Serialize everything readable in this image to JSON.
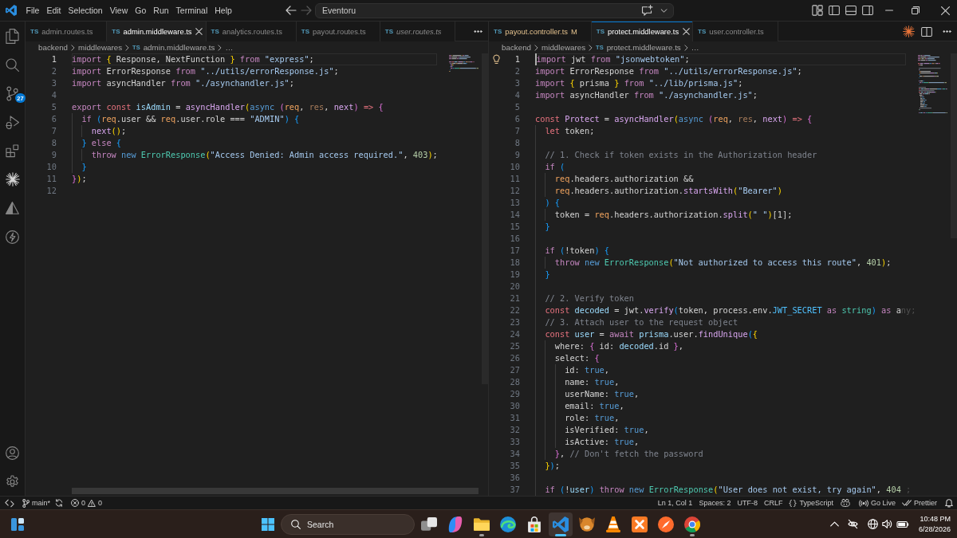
{
  "title_bar": {
    "menu": [
      "File",
      "Edit",
      "Selection",
      "View",
      "Go",
      "Run",
      "Terminal",
      "Help"
    ],
    "back_button": {
      "disabled": false
    },
    "forward_button": {
      "disabled": true
    },
    "command_center": {
      "text": "Eventoru"
    }
  },
  "activity_bar": {
    "source_control_badge": "27"
  },
  "editor_groups": [
    {
      "focused": false,
      "tabs": [
        {
          "file_type": "TS",
          "label": "admin.routes.ts",
          "selected": false,
          "preview": false,
          "modified": false
        },
        {
          "file_type": "TS",
          "label": "admin.middleware.ts",
          "selected": true,
          "preview": false,
          "modified": false
        },
        {
          "file_type": "TS",
          "label": "analytics.routes.ts",
          "selected": false,
          "preview": false,
          "modified": false
        },
        {
          "file_type": "TS",
          "label": "payout.routes.ts",
          "selected": false,
          "preview": false,
          "modified": false
        },
        {
          "file_type": "TS",
          "label": "user.routes.ts",
          "selected": false,
          "preview": true,
          "modified": false
        }
      ],
      "breadcrumb": {
        "folders": [
          "backend",
          "middlewares"
        ],
        "file_type": "TS",
        "file": "admin.middleware.ts",
        "symbol": "…"
      },
      "lines": [
        {
          "number": "1",
          "active": true,
          "tokens": [
            {
              "kind": "keyword",
              "text": "import "
            },
            {
              "kind": "bracket1",
              "text": "{"
            },
            {
              "kind": "plain",
              "text": " Response, NextFunction "
            },
            {
              "kind": "bracket1",
              "text": "} "
            },
            {
              "kind": "keyword",
              "text": "from "
            },
            {
              "kind": "string",
              "text": "\"express\""
            },
            {
              "kind": "plain",
              "text": ";"
            }
          ]
        },
        {
          "number": "2",
          "active": false,
          "tokens": [
            {
              "kind": "keyword",
              "text": "import"
            },
            {
              "kind": "plain",
              "text": " ErrorResponse "
            },
            {
              "kind": "keyword",
              "text": "from "
            },
            {
              "kind": "string",
              "text": "\"../utils/errorResponse.js\""
            },
            {
              "kind": "plain",
              "text": ";"
            }
          ]
        },
        {
          "number": "3",
          "active": false,
          "tokens": [
            {
              "kind": "keyword",
              "text": "import"
            },
            {
              "kind": "plain",
              "text": " asyncHandler "
            },
            {
              "kind": "keyword",
              "text": "from "
            },
            {
              "kind": "string",
              "text": "\"./asynchandler.js\""
            },
            {
              "kind": "plain",
              "text": ";"
            }
          ]
        },
        {
          "number": "4",
          "active": false
        },
        {
          "number": "5",
          "active": false,
          "tokens": [
            {
              "kind": "keyword",
              "text": "export "
            },
            {
              "kind": "storage",
              "text": "const "
            },
            {
              "kind": "variable",
              "text": "isAdmin"
            },
            {
              "kind": "plain",
              "text": " = "
            },
            {
              "kind": "function",
              "text": "asyncHandler"
            },
            {
              "kind": "bracket1",
              "text": "("
            },
            {
              "kind": "literal",
              "text": "async "
            },
            {
              "kind": "bracket2",
              "text": "("
            },
            {
              "kind": "parameter",
              "text": "req"
            },
            {
              "kind": "plain",
              "text": ", "
            },
            {
              "kind": "unused",
              "text": "res"
            },
            {
              "kind": "plain",
              "text": ", "
            },
            {
              "kind": "function",
              "text": "next"
            },
            {
              "kind": "bracket2",
              "text": ") "
            },
            {
              "kind": "storage",
              "text": "=> "
            },
            {
              "kind": "bracket2",
              "text": "{"
            }
          ]
        },
        {
          "number": "6",
          "active": false,
          "tokens": [
            {
              "kind": "keyword",
              "text": "  if "
            },
            {
              "kind": "bracket3",
              "text": "("
            },
            {
              "kind": "parameter",
              "text": "req"
            },
            {
              "kind": "plain",
              "text": ".user && "
            },
            {
              "kind": "parameter",
              "text": "req"
            },
            {
              "kind": "plain",
              "text": ".user.role === "
            },
            {
              "kind": "string",
              "text": "\"ADMIN\""
            },
            {
              "kind": "bracket3",
              "text": ") "
            },
            {
              "kind": "bracket3",
              "text": "{"
            }
          ]
        },
        {
          "number": "7",
          "active": false,
          "tokens": [
            {
              "kind": "function",
              "text": "    next"
            },
            {
              "kind": "bracket1",
              "text": "()"
            },
            {
              "kind": "plain",
              "text": ";"
            }
          ]
        },
        {
          "number": "8",
          "active": false,
          "tokens": [
            {
              "kind": "bracket3",
              "text": "  } "
            },
            {
              "kind": "keyword",
              "text": "else "
            },
            {
              "kind": "bracket3",
              "text": "{"
            }
          ]
        },
        {
          "number": "9",
          "active": false,
          "tokens": [
            {
              "kind": "keyword",
              "text": "    throw "
            },
            {
              "kind": "literal",
              "text": "new "
            },
            {
              "kind": "class",
              "text": "ErrorResponse"
            },
            {
              "kind": "bracket1",
              "text": "("
            },
            {
              "kind": "string",
              "text": "\"Access Denied: Admin access required.\""
            },
            {
              "kind": "plain",
              "text": ", "
            },
            {
              "kind": "number",
              "text": "403"
            },
            {
              "kind": "bracket1",
              "text": ")"
            },
            {
              "kind": "plain",
              "text": ";"
            }
          ]
        },
        {
          "number": "10",
          "active": false,
          "tokens": [
            {
              "kind": "bracket3",
              "text": "  }"
            }
          ]
        },
        {
          "number": "11",
          "active": false,
          "tokens": [
            {
              "kind": "bracket2",
              "text": "}"
            },
            {
              "kind": "bracket1",
              "text": ")"
            },
            {
              "kind": "plain",
              "text": ";"
            }
          ]
        },
        {
          "number": "12",
          "active": false
        }
      ]
    },
    {
      "focused": true,
      "lightbulb": true,
      "tabs": [
        {
          "file_type": "TS",
          "label": "payout.controller.ts",
          "git_status": "M",
          "selected": false,
          "preview": false,
          "modified": true
        },
        {
          "file_type": "TS",
          "label": "protect.middleware.ts",
          "selected": true,
          "preview": false,
          "modified": false
        },
        {
          "file_type": "TS",
          "label": "user.controller.ts",
          "selected": false,
          "preview": false,
          "modified": false
        }
      ],
      "breadcrumb": {
        "folders": [
          "backend",
          "middlewares"
        ],
        "file_type": "TS",
        "file": "protect.middleware.ts",
        "symbol": "…"
      },
      "lines": [
        {
          "number": "1",
          "active": true,
          "tokens": [
            {
              "kind": "keyword",
              "text": "import"
            },
            {
              "kind": "plain",
              "text": " jwt "
            },
            {
              "kind": "keyword",
              "text": "from "
            },
            {
              "kind": "string",
              "text": "\"jsonwebtoken\""
            },
            {
              "kind": "plain",
              "text": ";"
            }
          ]
        },
        {
          "number": "2",
          "active": false,
          "tokens": [
            {
              "kind": "keyword",
              "text": "import"
            },
            {
              "kind": "plain",
              "text": " ErrorResponse "
            },
            {
              "kind": "keyword",
              "text": "from "
            },
            {
              "kind": "string",
              "text": "\"../utils/errorResponse.js\""
            },
            {
              "kind": "plain",
              "text": ";"
            }
          ]
        },
        {
          "number": "3",
          "active": false,
          "tokens": [
            {
              "kind": "keyword",
              "text": "import "
            },
            {
              "kind": "bracket1",
              "text": "{"
            },
            {
              "kind": "plain",
              "text": " prisma "
            },
            {
              "kind": "bracket1",
              "text": "} "
            },
            {
              "kind": "keyword",
              "text": "from "
            },
            {
              "kind": "string",
              "text": "\"../lib/prisma.js\""
            },
            {
              "kind": "plain",
              "text": ";"
            }
          ]
        },
        {
          "number": "4",
          "active": false,
          "tokens": [
            {
              "kind": "keyword",
              "text": "import"
            },
            {
              "kind": "plain",
              "text": " asyncHandler "
            },
            {
              "kind": "keyword",
              "text": "from "
            },
            {
              "kind": "string",
              "text": "\"./asynchandler.js\""
            },
            {
              "kind": "plain",
              "text": ";"
            }
          ]
        },
        {
          "number": "5",
          "active": false
        },
        {
          "number": "6",
          "active": false,
          "tokens": [
            {
              "kind": "storage",
              "text": "const "
            },
            {
              "kind": "function",
              "text": "Protect"
            },
            {
              "kind": "plain",
              "text": " = "
            },
            {
              "kind": "function",
              "text": "asyncHandler"
            },
            {
              "kind": "bracket1",
              "text": "("
            },
            {
              "kind": "literal",
              "text": "async "
            },
            {
              "kind": "bracket2",
              "text": "("
            },
            {
              "kind": "parameter",
              "text": "req"
            },
            {
              "kind": "plain",
              "text": ", "
            },
            {
              "kind": "unused",
              "text": "res"
            },
            {
              "kind": "plain",
              "text": ", "
            },
            {
              "kind": "function",
              "text": "next"
            },
            {
              "kind": "bracket2",
              "text": ") "
            },
            {
              "kind": "storage",
              "text": "=> "
            },
            {
              "kind": "bracket2",
              "text": "{"
            }
          ]
        },
        {
          "number": "7",
          "active": false,
          "tokens": [
            {
              "kind": "storage",
              "text": "  let"
            },
            {
              "kind": "plain",
              "text": " token;"
            }
          ]
        },
        {
          "number": "8",
          "active": false
        },
        {
          "number": "9",
          "active": false,
          "tokens": [
            {
              "kind": "comment",
              "text": "  // 1. Check if token exists in the Authorization header"
            }
          ]
        },
        {
          "number": "10",
          "active": false,
          "tokens": [
            {
              "kind": "keyword",
              "text": "  if "
            },
            {
              "kind": "bracket3",
              "text": "("
            }
          ]
        },
        {
          "number": "11",
          "active": false,
          "tokens": [
            {
              "kind": "parameter",
              "text": "    req"
            },
            {
              "kind": "plain",
              "text": ".headers.authorization &&"
            }
          ]
        },
        {
          "number": "12",
          "active": false,
          "tokens": [
            {
              "kind": "parameter",
              "text": "    req"
            },
            {
              "kind": "plain",
              "text": ".headers.authorization."
            },
            {
              "kind": "function",
              "text": "startsWith"
            },
            {
              "kind": "bracket1",
              "text": "("
            },
            {
              "kind": "string",
              "text": "\"Bearer\""
            },
            {
              "kind": "bracket1",
              "text": ")"
            }
          ]
        },
        {
          "number": "13",
          "active": false,
          "tokens": [
            {
              "kind": "bracket3",
              "text": "  ) "
            },
            {
              "kind": "bracket3",
              "text": "{"
            }
          ]
        },
        {
          "number": "14",
          "active": false,
          "tokens": [
            {
              "kind": "plain",
              "text": "    token = "
            },
            {
              "kind": "parameter",
              "text": "req"
            },
            {
              "kind": "plain",
              "text": ".headers.authorization."
            },
            {
              "kind": "function",
              "text": "split"
            },
            {
              "kind": "bracket1",
              "text": "("
            },
            {
              "kind": "string",
              "text": "\" \""
            },
            {
              "kind": "bracket1",
              "text": ")"
            },
            {
              "kind": "plain",
              "text": "[1];"
            }
          ]
        },
        {
          "number": "15",
          "active": false,
          "tokens": [
            {
              "kind": "bracket3",
              "text": "  }"
            }
          ]
        },
        {
          "number": "16",
          "active": false
        },
        {
          "number": "17",
          "active": false,
          "tokens": [
            {
              "kind": "keyword",
              "text": "  if "
            },
            {
              "kind": "bracket3",
              "text": "("
            },
            {
              "kind": "plain",
              "text": "!token"
            },
            {
              "kind": "bracket3",
              "text": ") "
            },
            {
              "kind": "bracket3",
              "text": "{"
            }
          ]
        },
        {
          "number": "18",
          "active": false,
          "tokens": [
            {
              "kind": "keyword",
              "text": "    throw "
            },
            {
              "kind": "literal",
              "text": "new "
            },
            {
              "kind": "class",
              "text": "ErrorResponse"
            },
            {
              "kind": "bracket1",
              "text": "("
            },
            {
              "kind": "string",
              "text": "\"Not authorized to access this route\""
            },
            {
              "kind": "plain",
              "text": ", "
            },
            {
              "kind": "number",
              "text": "401"
            },
            {
              "kind": "bracket1",
              "text": ")"
            },
            {
              "kind": "plain",
              "text": ";"
            }
          ]
        },
        {
          "number": "19",
          "active": false,
          "tokens": [
            {
              "kind": "bracket3",
              "text": "  }"
            }
          ]
        },
        {
          "number": "20",
          "active": false
        },
        {
          "number": "21",
          "active": false,
          "tokens": [
            {
              "kind": "comment",
              "text": "  // 2. Verify token"
            }
          ]
        },
        {
          "number": "22",
          "active": false,
          "tokens": [
            {
              "kind": "storage",
              "text": "  const "
            },
            {
              "kind": "variable",
              "text": "decoded"
            },
            {
              "kind": "plain",
              "text": " = jwt."
            },
            {
              "kind": "function",
              "text": "verify"
            },
            {
              "kind": "bracket3",
              "text": "("
            },
            {
              "kind": "plain",
              "text": "token, process.env."
            },
            {
              "kind": "constant",
              "text": "JWT_SECRET "
            },
            {
              "kind": "keyword",
              "text": "as "
            },
            {
              "kind": "type",
              "text": "string"
            },
            {
              "kind": "bracket3",
              "text": ") "
            },
            {
              "kind": "keyword",
              "text": "as"
            },
            {
              "kind": "plain",
              "text": " a"
            },
            {
              "kind": "faded",
              "text": "ny;"
            }
          ]
        },
        {
          "number": "23",
          "active": false,
          "tokens": [
            {
              "kind": "comment",
              "text": "  // 3. Attach user to the request object"
            }
          ]
        },
        {
          "number": "24",
          "active": false,
          "tokens": [
            {
              "kind": "storage",
              "text": "  const "
            },
            {
              "kind": "variable",
              "text": "user"
            },
            {
              "kind": "plain",
              "text": " = "
            },
            {
              "kind": "keyword",
              "text": "await "
            },
            {
              "kind": "variable",
              "text": "prisma"
            },
            {
              "kind": "plain",
              "text": ".user."
            },
            {
              "kind": "function",
              "text": "findUnique"
            },
            {
              "kind": "bracket3",
              "text": "("
            },
            {
              "kind": "bracket1",
              "text": "{"
            }
          ]
        },
        {
          "number": "25",
          "active": false,
          "tokens": [
            {
              "kind": "plain",
              "text": "    where: "
            },
            {
              "kind": "bracket2",
              "text": "{"
            },
            {
              "kind": "plain",
              "text": " id: "
            },
            {
              "kind": "variable",
              "text": "decoded"
            },
            {
              "kind": "plain",
              "text": ".id "
            },
            {
              "kind": "bracket2",
              "text": "}"
            },
            {
              "kind": "plain",
              "text": ","
            }
          ]
        },
        {
          "number": "26",
          "active": false,
          "tokens": [
            {
              "kind": "plain",
              "text": "    select: "
            },
            {
              "kind": "bracket2",
              "text": "{"
            }
          ]
        },
        {
          "number": "27",
          "active": false,
          "tokens": [
            {
              "kind": "plain",
              "text": "      id: "
            },
            {
              "kind": "literal",
              "text": "true"
            },
            {
              "kind": "plain",
              "text": ","
            }
          ]
        },
        {
          "number": "28",
          "active": false,
          "tokens": [
            {
              "kind": "plain",
              "text": "      name: "
            },
            {
              "kind": "literal",
              "text": "true"
            },
            {
              "kind": "plain",
              "text": ","
            }
          ]
        },
        {
          "number": "29",
          "active": false,
          "tokens": [
            {
              "kind": "plain",
              "text": "      userName: "
            },
            {
              "kind": "literal",
              "text": "true"
            },
            {
              "kind": "plain",
              "text": ","
            }
          ]
        },
        {
          "number": "30",
          "active": false,
          "tokens": [
            {
              "kind": "plain",
              "text": "      email: "
            },
            {
              "kind": "literal",
              "text": "true"
            },
            {
              "kind": "plain",
              "text": ","
            }
          ]
        },
        {
          "number": "31",
          "active": false,
          "tokens": [
            {
              "kind": "plain",
              "text": "      role: "
            },
            {
              "kind": "literal",
              "text": "true"
            },
            {
              "kind": "plain",
              "text": ","
            }
          ]
        },
        {
          "number": "32",
          "active": false,
          "tokens": [
            {
              "kind": "plain",
              "text": "      isVerified: "
            },
            {
              "kind": "literal",
              "text": "true"
            },
            {
              "kind": "plain",
              "text": ","
            }
          ]
        },
        {
          "number": "33",
          "active": false,
          "tokens": [
            {
              "kind": "plain",
              "text": "      isActive: "
            },
            {
              "kind": "literal",
              "text": "true"
            },
            {
              "kind": "plain",
              "text": ","
            }
          ]
        },
        {
          "number": "34",
          "active": false,
          "tokens": [
            {
              "kind": "bracket2",
              "text": "    }"
            },
            {
              "kind": "plain",
              "text": ", "
            },
            {
              "kind": "comment",
              "text": "// Don't fetch the password"
            }
          ]
        },
        {
          "number": "35",
          "active": false,
          "tokens": [
            {
              "kind": "bracket1",
              "text": "  }"
            },
            {
              "kind": "bracket3",
              "text": ")"
            },
            {
              "kind": "plain",
              "text": ";"
            }
          ]
        },
        {
          "number": "36",
          "active": false
        },
        {
          "number": "37",
          "active": false,
          "tokens": [
            {
              "kind": "keyword",
              "text": "  if "
            },
            {
              "kind": "bracket3",
              "text": "("
            },
            {
              "kind": "plain",
              "text": "!"
            },
            {
              "kind": "variable",
              "text": "user"
            },
            {
              "kind": "bracket3",
              "text": ") "
            },
            {
              "kind": "keyword",
              "text": "throw "
            },
            {
              "kind": "literal",
              "text": "new "
            },
            {
              "kind": "class",
              "text": "ErrorResponse"
            },
            {
              "kind": "bracket1",
              "text": "("
            },
            {
              "kind": "string",
              "text": "\"User does not exist, try again\""
            },
            {
              "kind": "plain",
              "text": ", "
            },
            {
              "kind": "number",
              "text": "404"
            },
            {
              "kind": "faded",
              "text": " ;"
            }
          ]
        }
      ]
    }
  ],
  "status_bar": {
    "branch": "main*",
    "errors": "0",
    "warnings": "0",
    "cursor_position": "Ln 1, Col 1",
    "indentation": "Spaces: 2",
    "encoding": "UTF-8",
    "line_endings": "CRLF",
    "language": "TypeScript",
    "live_server": "Go Live",
    "formatter": "Prettier"
  },
  "taskbar": {
    "search": {
      "placeholder": "Search"
    },
    "apps": [
      {
        "running": false,
        "selected": false
      },
      {
        "running": false,
        "selected": false
      },
      {
        "running": true,
        "selected": false
      },
      {
        "running": false,
        "selected": false
      },
      {
        "running": false,
        "selected": false
      },
      {
        "running": true,
        "selected": true
      },
      {
        "running": false,
        "selected": false
      },
      {
        "running": false,
        "selected": false
      },
      {
        "running": false,
        "selected": false
      },
      {
        "running": false,
        "selected": false
      },
      {
        "running": true,
        "selected": false
      }
    ],
    "time": "10:48 PM",
    "date": "6/28/2026"
  }
}
